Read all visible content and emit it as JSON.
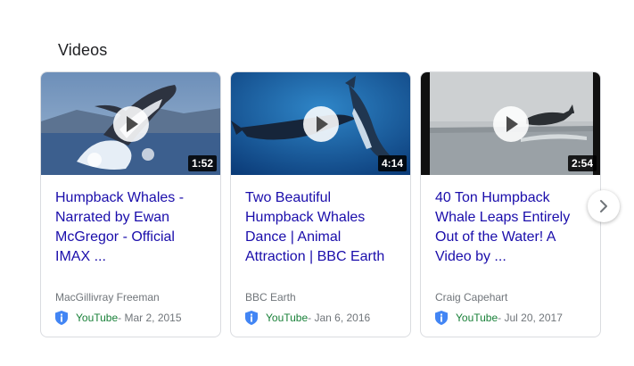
{
  "section": {
    "title": "Videos"
  },
  "videos": [
    {
      "title": "Humpback Whales - Narrated by Ewan McGregor - Official IMAX ...",
      "duration": "1:52",
      "channel": "MacGillivray Freeman",
      "site": "YouTube",
      "date": " - Mar 2, 2015"
    },
    {
      "title": "Two Beautiful Humpback Whales Dance | Animal Attraction | BBC Earth",
      "duration": "4:14",
      "channel": "BBC Earth",
      "site": "YouTube",
      "date": " - Jan 6, 2016"
    },
    {
      "title": "40 Ton Humpback Whale Leaps Entirely Out of the Water! A Video by ...",
      "duration": "2:54",
      "channel": "Craig Capehart",
      "site": "YouTube",
      "date": " - Jul 20, 2017"
    }
  ],
  "icons": {
    "play": "play-icon",
    "shield": "shield-icon",
    "next": "chevron-right-icon"
  },
  "colors": {
    "link": "#1a0dab",
    "site": "#188038",
    "meta": "#70757a",
    "shield": "#4285f4"
  }
}
